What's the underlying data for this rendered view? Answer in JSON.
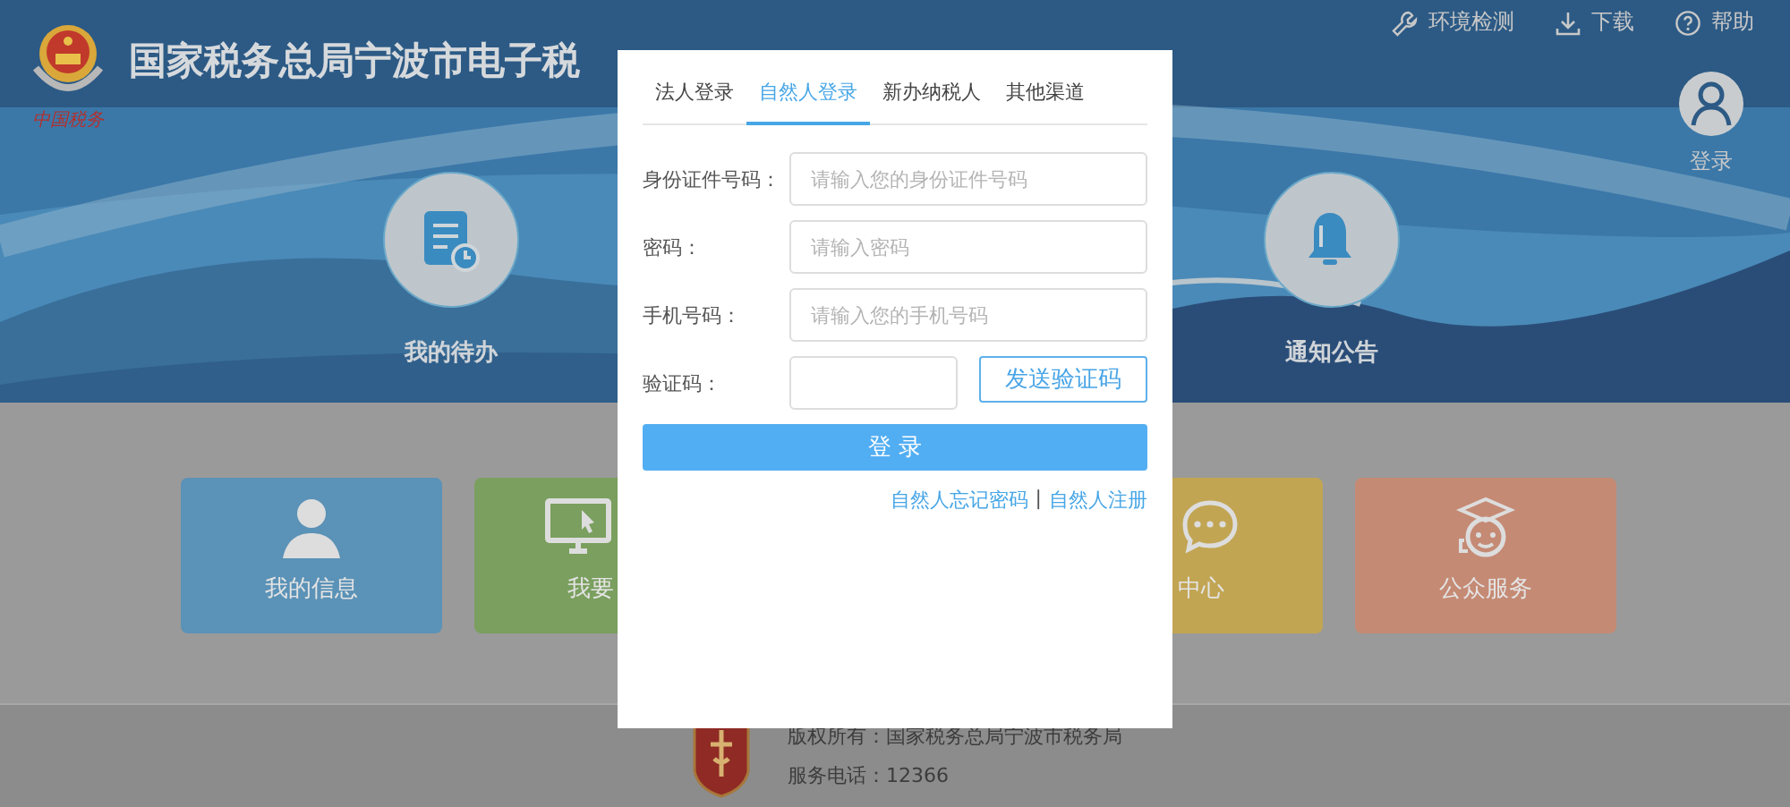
{
  "header": {
    "title": "国家税务总局宁波市电子税",
    "logo_caption": "中国税务",
    "links": [
      {
        "label": "环境检测"
      },
      {
        "label": "下载"
      },
      {
        "label": "帮助"
      }
    ],
    "user_login": "登录",
    "shortcuts": [
      {
        "label": "我的待办"
      },
      {
        "label": "通知公告"
      }
    ]
  },
  "tiles": [
    {
      "label": "我的信息",
      "color": "#5b92b7"
    },
    {
      "label": "我要",
      "color": "#7a9f5e"
    },
    {
      "label": "中心",
      "color": "#c2a553"
    },
    {
      "label": "公众服务",
      "color": "#c58a74"
    }
  ],
  "login": {
    "tabs": [
      {
        "label": "法人登录",
        "selected": false
      },
      {
        "label": "自然人登录",
        "selected": true
      },
      {
        "label": "新办纳税人",
        "selected": false
      },
      {
        "label": "其他渠道",
        "selected": false
      }
    ],
    "fields": [
      {
        "kind": "text",
        "label": "身份证件号码：",
        "placeholder": "请输入您的身份证件号码"
      },
      {
        "kind": "password",
        "label": "密码：",
        "placeholder": "请输入密码"
      },
      {
        "kind": "text",
        "label": "手机号码：",
        "placeholder": "请输入您的手机号码"
      },
      {
        "kind": "captcha",
        "label": "验证码："
      }
    ],
    "send_code_button": "发送验证码",
    "submit_button": "登 录",
    "links": [
      "自然人忘记密码",
      "自然人注册"
    ],
    "separator": "|"
  },
  "footer": {
    "copyright": "版权所有：国家税务总局宁波市税务局",
    "phone": "服务电话：12366"
  }
}
